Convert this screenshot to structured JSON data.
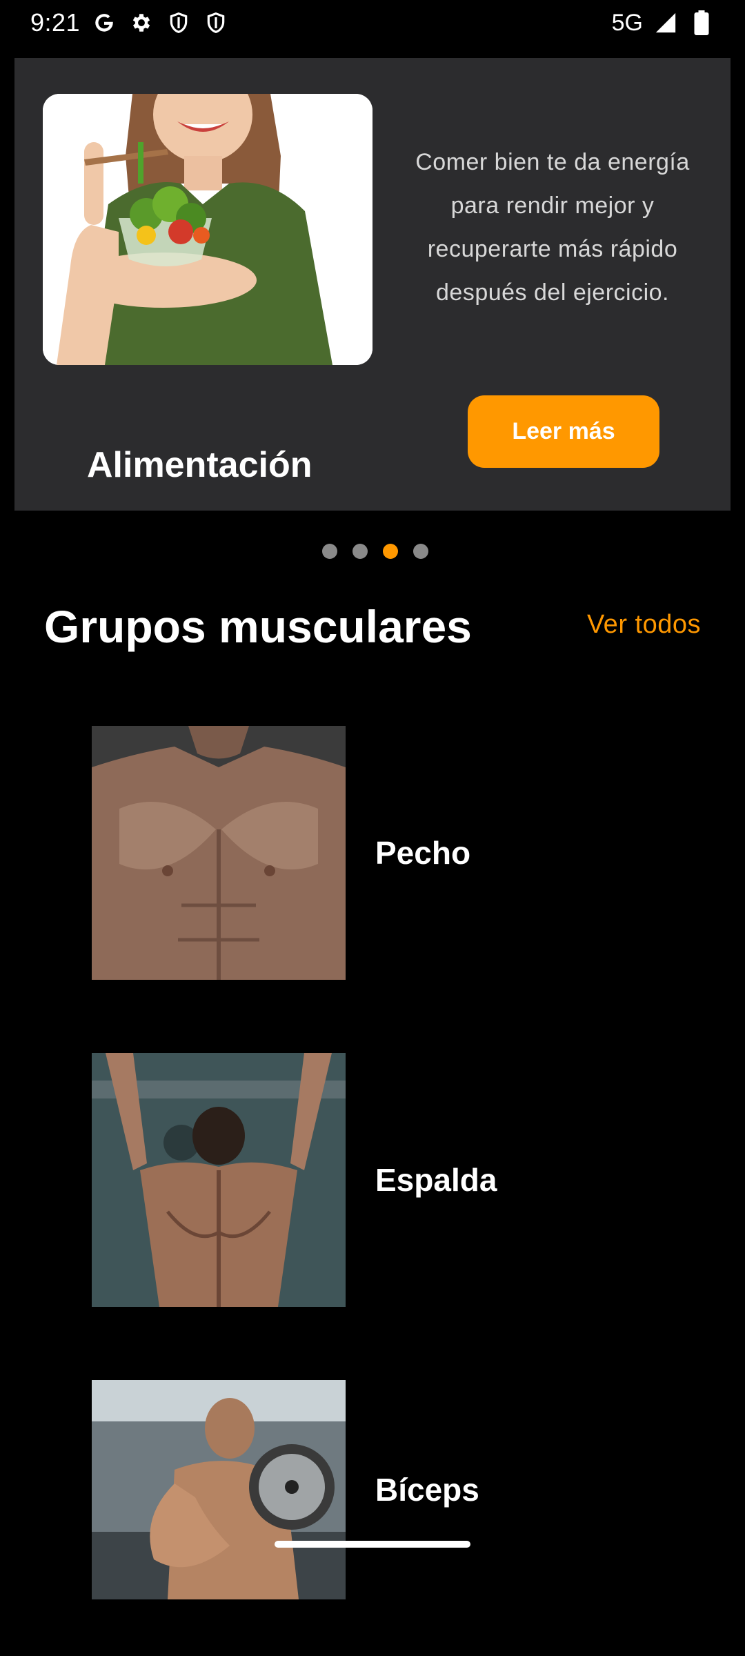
{
  "status_bar": {
    "time": "9:21",
    "network": "5G",
    "icons": [
      "google-icon",
      "settings-icon",
      "shield-icon",
      "shield-icon",
      "signal-icon",
      "battery-icon"
    ]
  },
  "promo": {
    "text": "Comer bien te da energía para rendir mejor y recuperarte más rápido después del ejercicio.",
    "title": "Alimentación",
    "button_label": "Leer más",
    "image": "woman-eating-salad"
  },
  "carousel": {
    "dot_count": 4,
    "active_index": 2
  },
  "section": {
    "title": "Grupos musculares",
    "link_label": "Ver todos"
  },
  "muscles": [
    {
      "label": "Pecho",
      "image": "chest-photo"
    },
    {
      "label": "Espalda",
      "image": "back-photo"
    },
    {
      "label": "Bíceps",
      "image": "biceps-photo"
    }
  ],
  "colors": {
    "accent": "#ff9800",
    "card": "#2c2c2e",
    "background": "#000000",
    "dot_inactive": "#8a8a8a"
  }
}
